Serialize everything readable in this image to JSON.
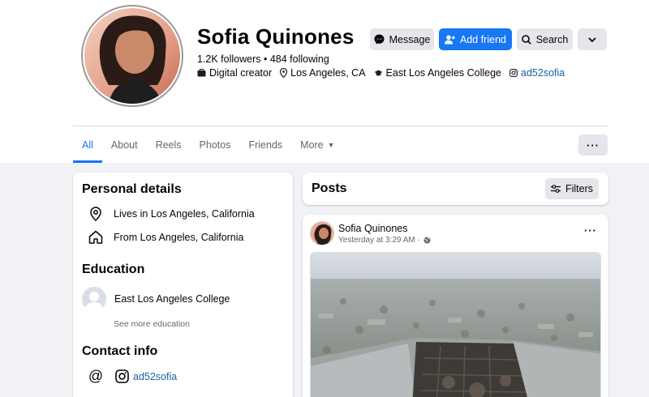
{
  "profile": {
    "name": "Sofia Quinones",
    "counts": "1.2K followers • 484 following",
    "meta": {
      "role": "Digital creator",
      "location": "Los Angeles, CA",
      "school": "East Los Angeles College",
      "instagram": "ad52sofia"
    }
  },
  "actions": {
    "message": "Message",
    "add_friend": "Add friend",
    "search": "Search"
  },
  "tabs": [
    "All",
    "About",
    "Reels",
    "Photos",
    "Friends",
    "More"
  ],
  "personal_details": {
    "title": "Personal details",
    "lives_in": "Lives in Los Angeles, California",
    "from": "From Los Angeles, California"
  },
  "education": {
    "title": "Education",
    "school": "East Los Angeles College",
    "see_more": "See more education"
  },
  "contact": {
    "title": "Contact info",
    "instagram": "ad52sofia"
  },
  "posts": {
    "title": "Posts",
    "filters": "Filters"
  },
  "post": {
    "author": "Sofia Quinones",
    "time": "Yesterday at 3:29 AM ·"
  },
  "colors": {
    "accent": "#1877f2",
    "button_grey": "#e4e6eb",
    "background": "#f0f2f5",
    "link": "#1b5fa8"
  },
  "icons": {
    "message": "messenger-icon",
    "add_friend": "person-add-icon",
    "search": "search-icon",
    "dropdown": "chevron-down-icon",
    "filters": "sliders-icon",
    "globe": "globe-icon"
  }
}
